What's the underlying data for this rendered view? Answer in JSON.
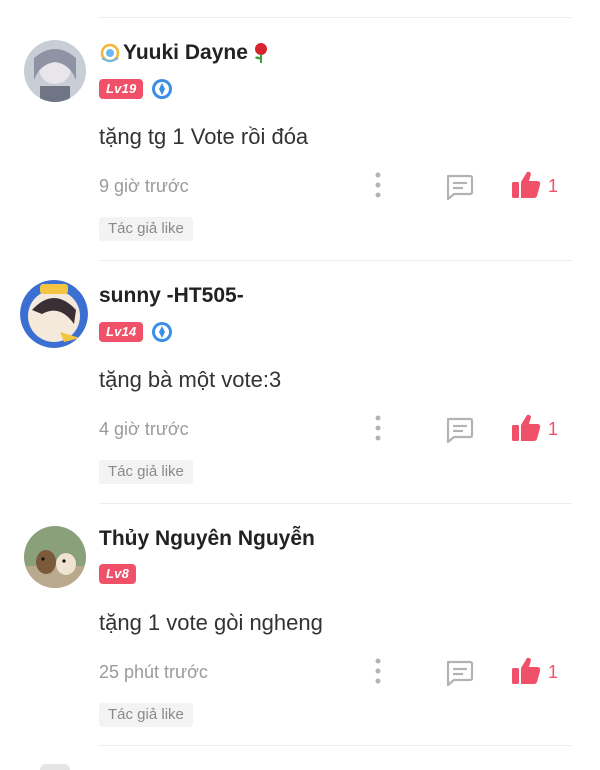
{
  "comments": [
    {
      "username": "Yuuki Dayne",
      "level": "Lv19",
      "verified": true,
      "text": "tặng tg 1 Vote rồi đóa",
      "time": "9 giờ trước",
      "likes": "1",
      "author_like": "Tác giả like"
    },
    {
      "username": "sunny -HT505-",
      "level": "Lv14",
      "verified": true,
      "text": "tặng bà một vote:3",
      "time": "4 giờ trước",
      "likes": "1",
      "author_like": "Tác giả like"
    },
    {
      "username": "Thủy Nguyên Nguyễn",
      "level": "Lv8",
      "verified": false,
      "text": "tặng 1 vote gòi ngheng",
      "time": "25 phút trước",
      "likes": "1",
      "author_like": "Tác giả like"
    }
  ],
  "colors": {
    "accent": "#f05068",
    "verify": "#3a8ee6",
    "muted": "#9a9a9a"
  }
}
